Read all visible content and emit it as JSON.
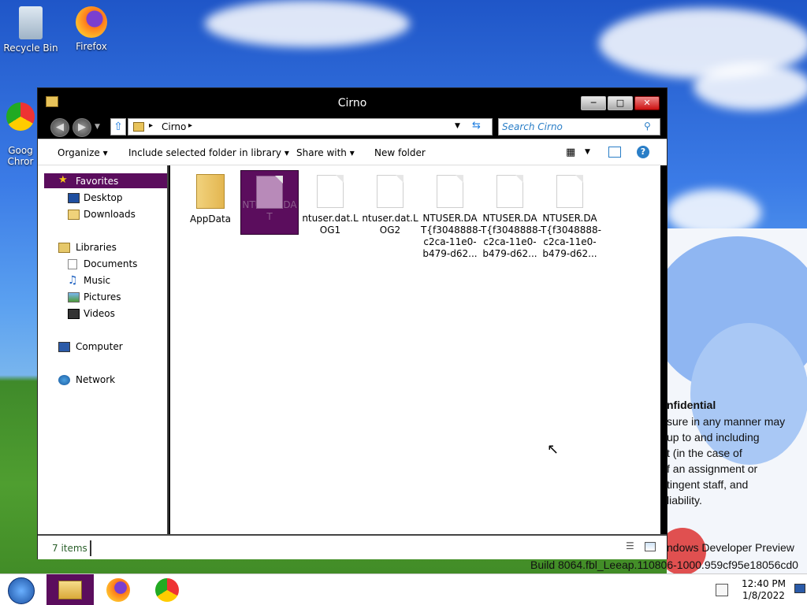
{
  "desktop": {
    "icons": [
      {
        "label": "Recycle Bin"
      },
      {
        "label": "Firefox"
      },
      {
        "label": "Goog\nChror"
      }
    ],
    "watermark": {
      "line1": "nfidential",
      "line2": "sure in any manner may",
      "line3": "up to and including",
      "line4": "t (in the case of",
      "line5": "f an assignment or",
      "line6": "tingent staff, and",
      "line7": "liability.",
      "line8": "ndows Developer Preview",
      "line9": "Build 8064.fbl_Leeap.110806-1000.959cf95e18056cd0"
    }
  },
  "window": {
    "title": "Cirno",
    "address": {
      "path": "Cirno"
    },
    "search": {
      "placeholder": "Search Cirno"
    },
    "commands": {
      "organize": "Organize",
      "include": "Include selected folder in library",
      "share": "Share with",
      "new_folder": "New folder"
    },
    "nav": {
      "favorites": "Favorites",
      "desktop": "Desktop",
      "downloads": "Downloads",
      "libraries": "Libraries",
      "documents": "Documents",
      "music": "Music",
      "pictures": "Pictures",
      "videos": "Videos",
      "computer": "Computer",
      "network": "Network"
    },
    "files": [
      {
        "name": "AppData",
        "kind": "folder"
      },
      {
        "name": "NTUSER.DA\nT",
        "kind": "file",
        "selected": true
      },
      {
        "name": "ntuser.dat.L\nOG1",
        "kind": "file"
      },
      {
        "name": "ntuser.dat.L\nOG2",
        "kind": "file"
      },
      {
        "name": "NTUSER.DA\nT{f3048888-\nc2ca-11e0-\nb479-d62...",
        "kind": "file"
      },
      {
        "name": "NTUSER.DA\nT{f3048888-\nc2ca-11e0-\nb479-d62...",
        "kind": "file"
      },
      {
        "name": "NTUSER.DA\nT{f3048888-\nc2ca-11e0-\nb479-d62...",
        "kind": "file"
      }
    ],
    "status": {
      "count": "7 items"
    }
  },
  "taskbar": {
    "time": "12:40 PM",
    "date": "1/8/2022"
  },
  "colors": {
    "accent": "#5b0d5d",
    "titlebar": "#000000"
  }
}
